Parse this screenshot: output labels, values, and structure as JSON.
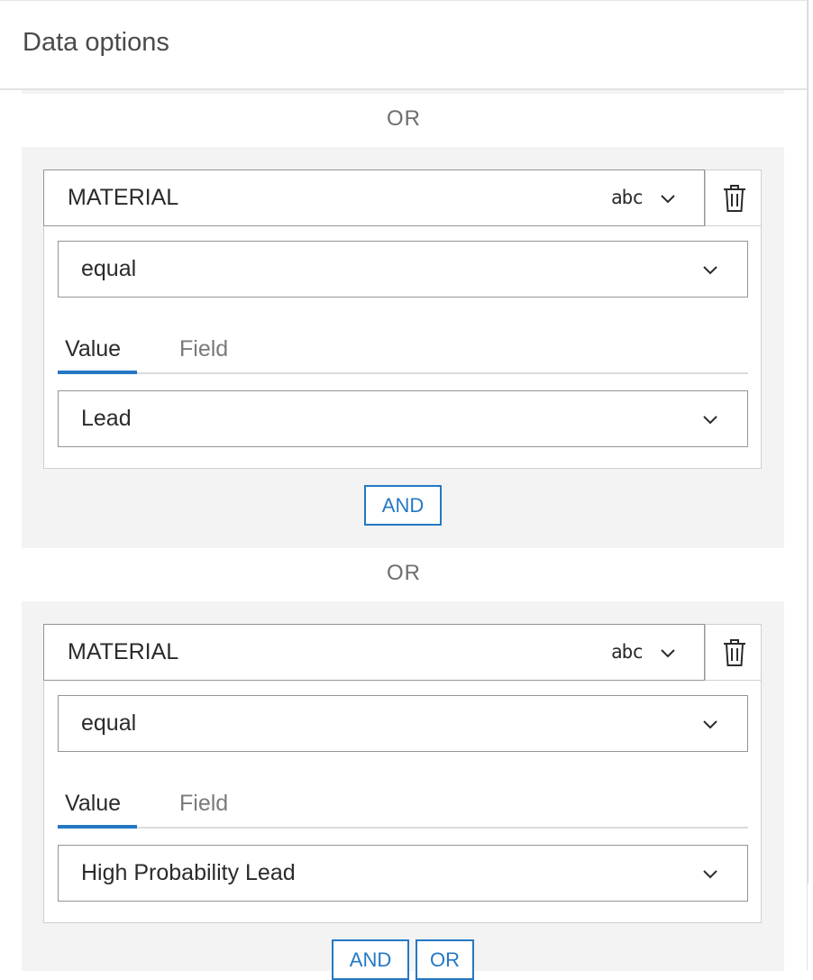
{
  "header": {
    "title": "Data options"
  },
  "separator_label": "OR",
  "groups": [
    {
      "field": "MATERIAL",
      "type_tag": "abc",
      "operator": "equal",
      "tabs": [
        "Value",
        "Field"
      ],
      "value": "Lead",
      "and_label": "AND"
    },
    {
      "field": "MATERIAL",
      "type_tag": "abc",
      "operator": "equal",
      "tabs": [
        "Value",
        "Field"
      ],
      "value": "High Probability Lead",
      "and_label": "AND",
      "or_label": "OR"
    }
  ],
  "colors": {
    "accent": "#2578c4",
    "group_bg": "#f3f3f3",
    "border": "#959595"
  },
  "icons": {
    "dropdown": "chevron-down-icon",
    "delete": "trash-icon"
  }
}
